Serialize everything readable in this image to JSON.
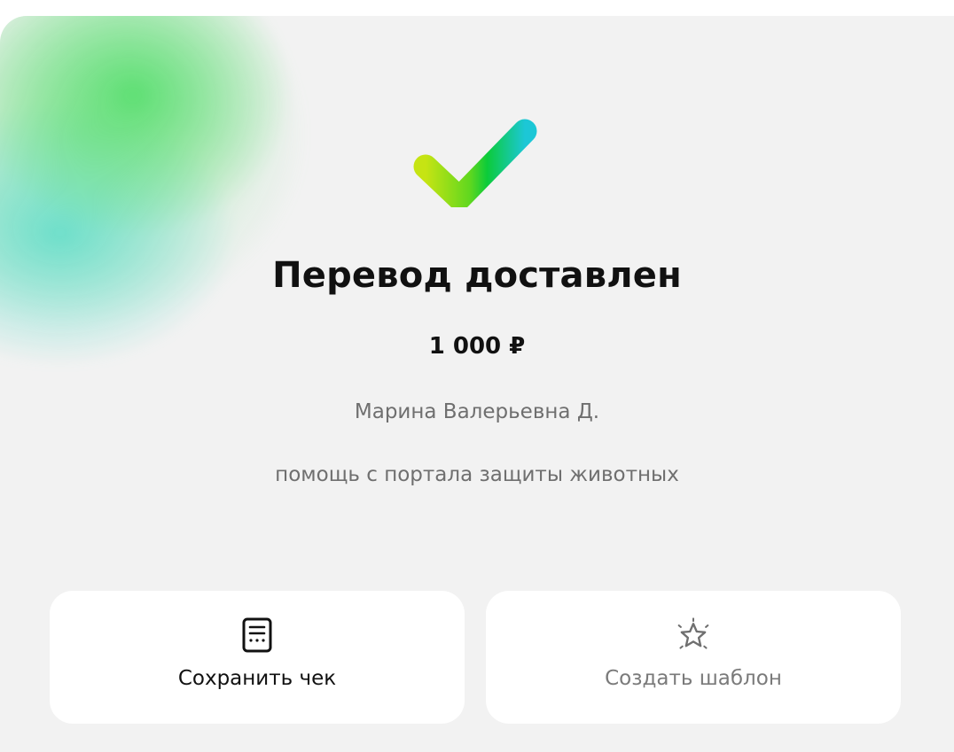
{
  "status": {
    "title": "Перевод доставлен",
    "amount": "1 000 ₽",
    "recipient": "Марина Валерьевна Д.",
    "comment": "помощь с портала защиты животных"
  },
  "actions": {
    "save_receipt": {
      "label": "Сохранить чек",
      "icon": "receipt-icon"
    },
    "create_template": {
      "label": "Создать шаблон",
      "icon": "star-icon"
    }
  },
  "colors": {
    "check_gradient_start": "#c6e413",
    "check_gradient_mid": "#0ccb3a",
    "check_gradient_end": "#1cc7d6",
    "background": "#f2f2f2",
    "card": "#ffffff",
    "primary_text": "#111111",
    "secondary_text": "#6f6f6f"
  }
}
